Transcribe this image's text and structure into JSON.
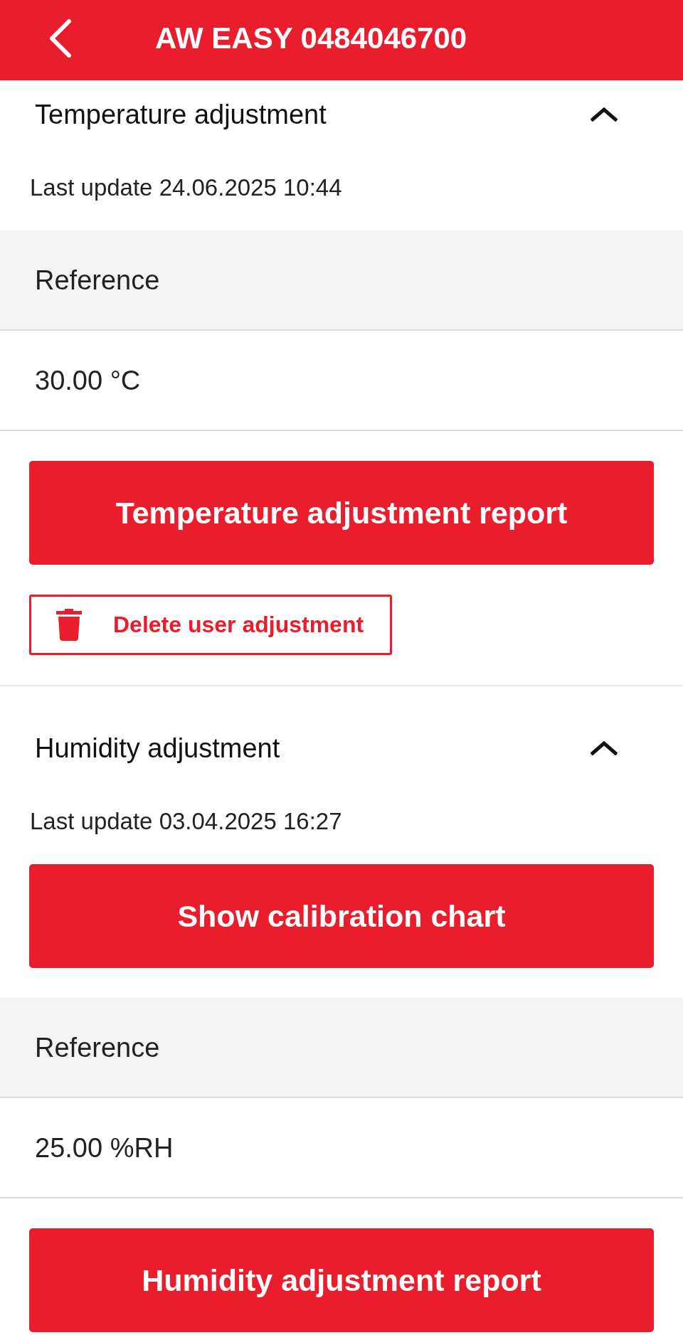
{
  "app_bar": {
    "title": "AW EASY 0484046700"
  },
  "sections": [
    {
      "title": "Temperature adjustment",
      "expanded": true,
      "last_update": "Last update 24.06.2025 10:44",
      "items": [
        {
          "kind": "reference",
          "label": "Reference",
          "value": "30.00 °C"
        },
        {
          "kind": "primary",
          "label": "Temperature adjustment report"
        },
        {
          "kind": "outline",
          "label": "Delete user adjustment"
        }
      ]
    },
    {
      "title": "Humidity adjustment",
      "expanded": true,
      "last_update": "Last update 03.04.2025 16:27",
      "items": [
        {
          "kind": "primary",
          "label": "Show calibration chart"
        },
        {
          "kind": "reference",
          "label": "Reference",
          "value": "25.00 %RH"
        },
        {
          "kind": "primary",
          "label": "Humidity adjustment report"
        }
      ]
    }
  ]
}
